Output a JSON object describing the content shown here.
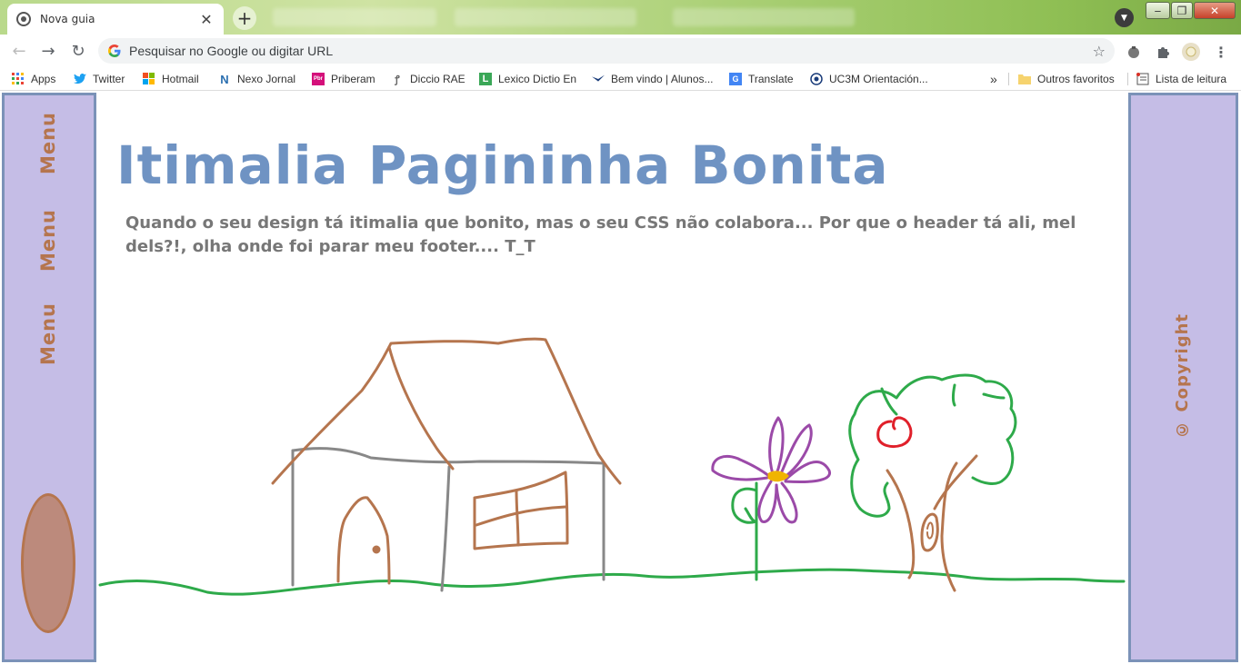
{
  "browser": {
    "tab_title": "Nova guia",
    "tab_close": "✕",
    "new_tab": "+",
    "omnibox_placeholder": "Pesquisar no Google ou digitar URL",
    "window_controls": [
      "‒",
      "❐",
      "✕"
    ],
    "icons": [
      "chrome-icon",
      "back-icon",
      "forward-icon",
      "reload-icon",
      "google-icon",
      "star-icon",
      "extension-icon",
      "puzzle-icon",
      "profile-icon",
      "menu-kebab-icon"
    ]
  },
  "bookmarks": {
    "items": [
      {
        "label": "Apps",
        "icon": "apps-grid-icon"
      },
      {
        "label": "Twitter",
        "icon": "twitter-icon"
      },
      {
        "label": "Hotmail",
        "icon": "microsoft-icon"
      },
      {
        "label": "Nexo Jornal",
        "icon": "nexo-icon"
      },
      {
        "label": "Priberam",
        "icon": "priberam-icon"
      },
      {
        "label": "Diccio RAE",
        "icon": "rae-icon"
      },
      {
        "label": "Lexico Dictio En",
        "icon": "lexico-icon"
      },
      {
        "label": "Bem vindo | Alunos...",
        "icon": "alunos-icon"
      },
      {
        "label": "Translate",
        "icon": "translate-icon"
      },
      {
        "label": "UC3M Orientación...",
        "icon": "uc3m-icon"
      }
    ],
    "overflow": "»",
    "other_favorites": "Outros favoritos",
    "reading_list": "Lista de leitura"
  },
  "page": {
    "title": "Itimalia Pagininha Bonita",
    "subtitle": "Quando o seu design tá itimalia que bonito, mas o seu CSS não colabora... Por que o header tá ali, mel dels?!, olha onde foi parar meu footer.... T_T",
    "menu_items": [
      "Menu",
      "Menu",
      "Menu"
    ],
    "copyright": "© Copyright"
  },
  "colors": {
    "sidebar_bg": "#c5bde6",
    "sidebar_border": "#7b92b8",
    "title_color": "#6f93c3",
    "menu_text": "#b5754e",
    "grass": "#2eaa4a",
    "house_roof": "#b5754e",
    "house_wall": "#888888",
    "flower": "#9b4aa8",
    "apple": "#e0202a"
  }
}
